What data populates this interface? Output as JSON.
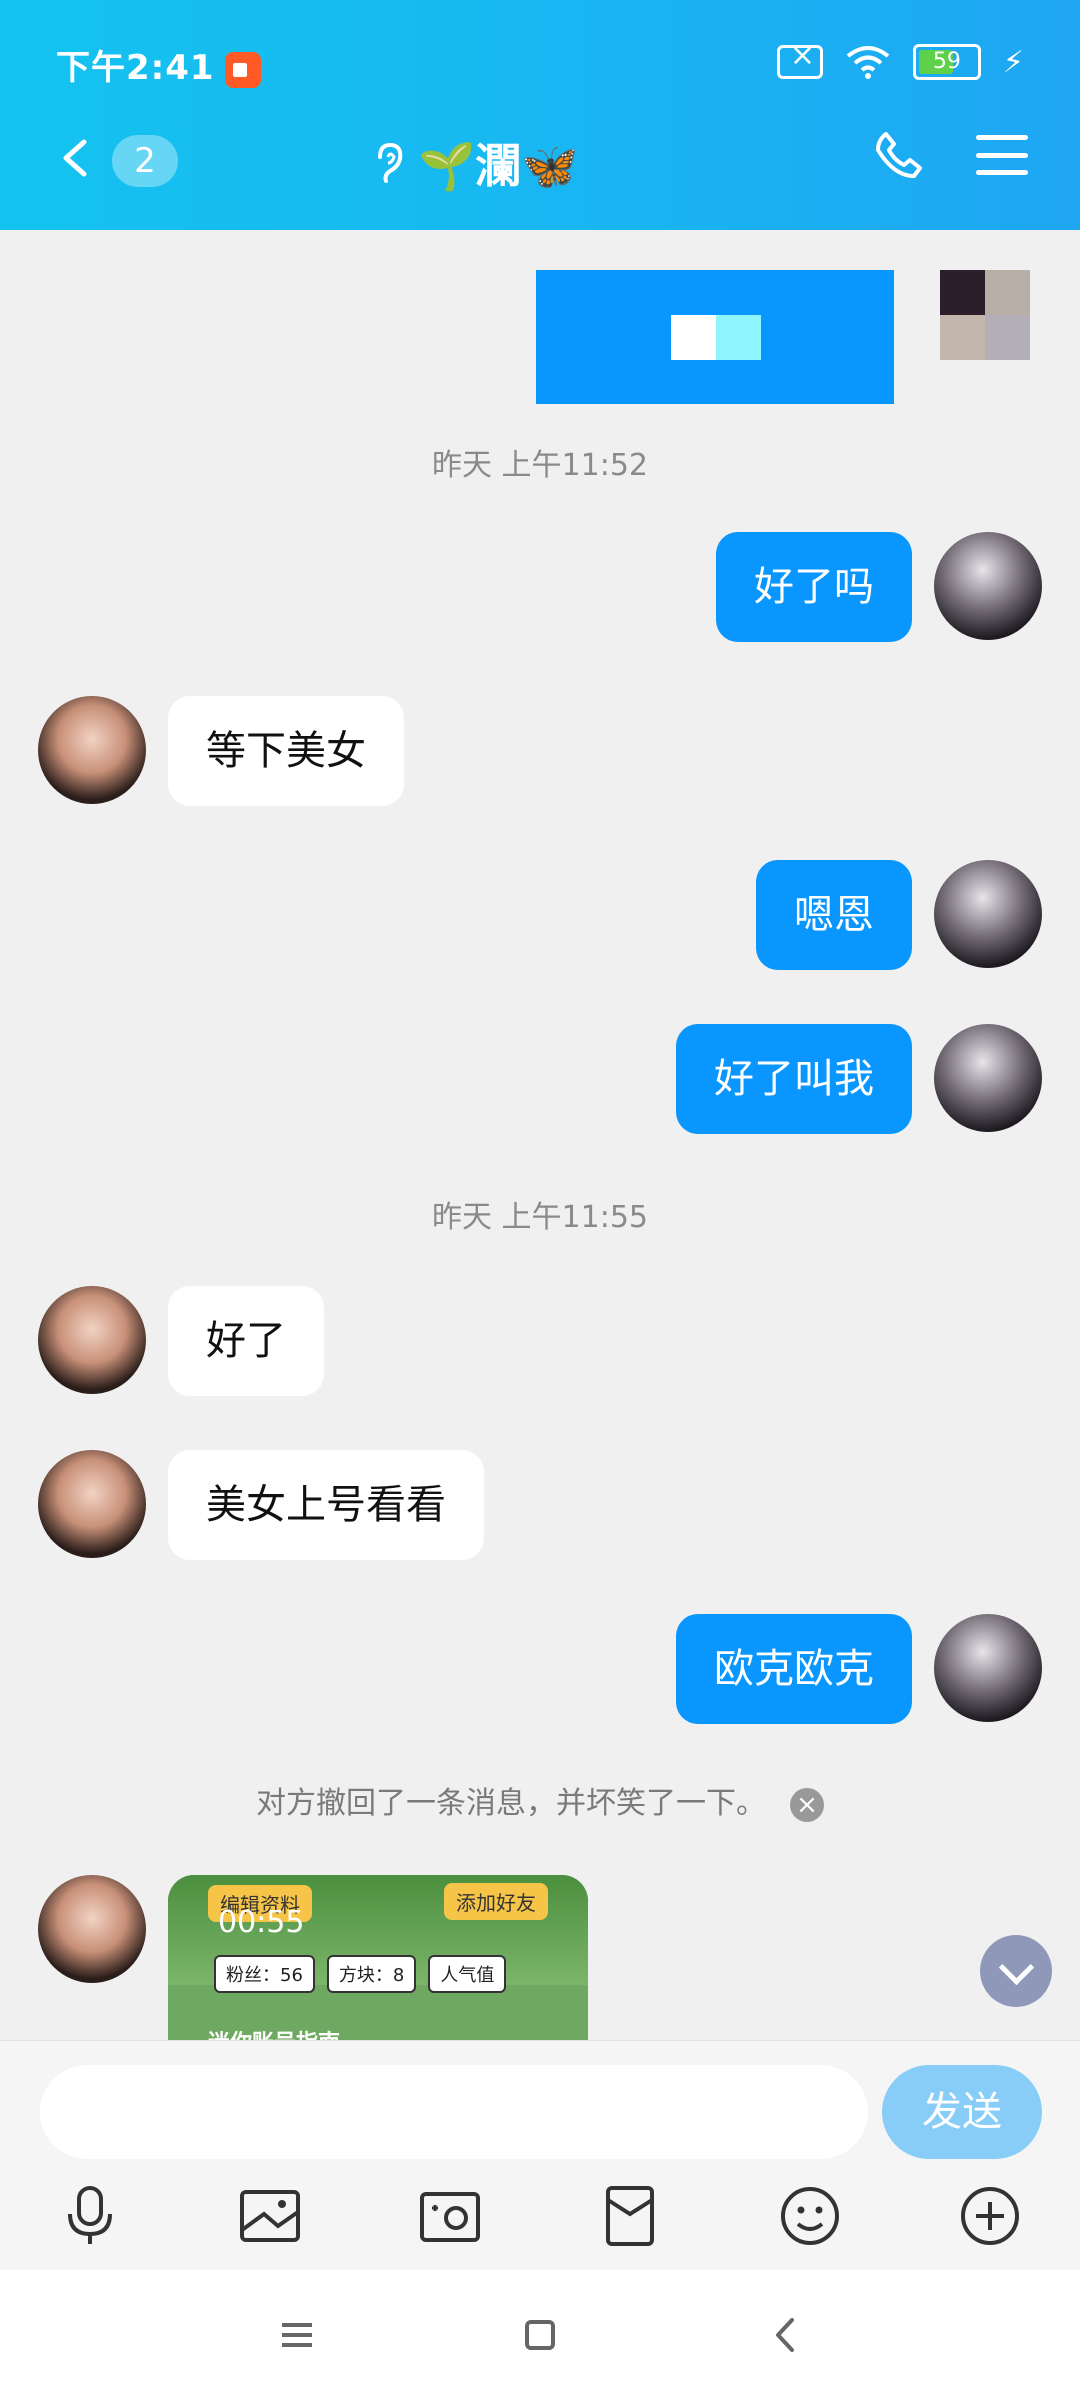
{
  "status_bar": {
    "time": "下午2:41",
    "battery": "59"
  },
  "header": {
    "unread_count": "2",
    "contact_name": "🌱瀾🦋"
  },
  "chat": {
    "messages": [
      {
        "side": "out",
        "text": "好了吗"
      },
      {
        "side": "in",
        "text": "等下美女"
      },
      {
        "side": "out",
        "text": "嗯恩"
      },
      {
        "side": "out",
        "text": "好了叫我"
      },
      {
        "side": "in",
        "text": "好了"
      },
      {
        "side": "in",
        "text": "美女上号看看"
      },
      {
        "side": "out",
        "text": "欧克欧克"
      }
    ],
    "timestamps": [
      "昨天 上午11:52",
      "昨天 上午11:55"
    ],
    "recall_notice": "对方撤回了一条消息，并坏笑了一下。",
    "video_card": {
      "edit_tag": "编辑资料",
      "add_friend_tag": "添加好友",
      "duration": "00:55",
      "fans": "粉丝：56",
      "blocks": "方块：8",
      "popularity": "人气值",
      "title": "迷你账号指南"
    }
  },
  "input": {
    "placeholder": "",
    "send_label": "发送"
  },
  "colors": {
    "header_start": "#14c3ef",
    "header_end": "#1ea6f3",
    "bubble_out": "#0a96ff",
    "send_disabled": "#87cdf8"
  }
}
